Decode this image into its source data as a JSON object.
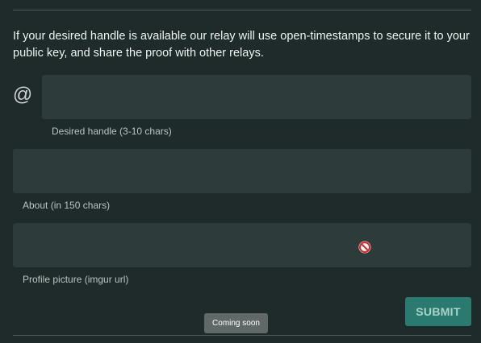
{
  "intro_text": "If your desired handle is available our relay will use open-timestamps to secure it to your public key, and share the proof with other relays.",
  "handle": {
    "prefix_icon": "at-icon",
    "prefix_glyph": "@",
    "value": "",
    "helper": "Desired handle (3-10 chars)"
  },
  "about": {
    "value": "",
    "helper": "About (in 150 chars)"
  },
  "picture": {
    "value": "",
    "helper": "Profile picture (imgur url)",
    "cursor_icon": "not-allowed-icon"
  },
  "submit_label": "SUBMIT",
  "tooltip": "Coming soon",
  "colors": {
    "background": "#1f2a2a",
    "field": "#2d3c3b",
    "accent": "#2b7a6f",
    "not_allowed": "#d32f2f"
  }
}
